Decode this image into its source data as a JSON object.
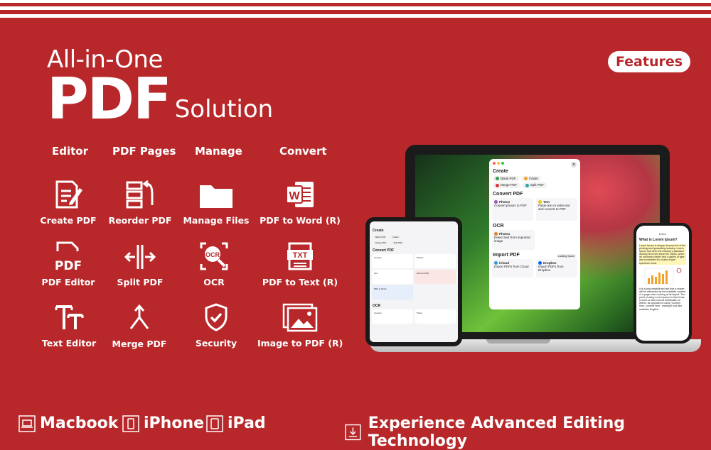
{
  "headline": {
    "line1": "All-in-One",
    "pdf": "PDF",
    "solution": "Solution"
  },
  "badge": "Features",
  "columns": [
    "Editor",
    "PDF Pages",
    "Manage",
    "Convert"
  ],
  "features": [
    [
      "Create PDF",
      "Reorder PDF",
      "Manage Files",
      "PDF to Word (R)"
    ],
    [
      "PDF Editor",
      "Split PDF",
      "OCR",
      "PDF to Text (R)"
    ],
    [
      "Text Editor",
      "Merge PDF",
      "Security",
      "Image to PDF (R)"
    ]
  ],
  "icon_text": {
    "pdf": "PDF",
    "ocr": "OCR",
    "txt": "TXT",
    "word": "W"
  },
  "platforms": [
    "Macbook",
    "iPhone",
    "iPad"
  ],
  "tagline": "Experience Advanced Editing Technology",
  "mac_app": {
    "create_title": "Create",
    "create_items": [
      "Blank PDF",
      "Folder",
      "Merge PDF",
      "Split PDF"
    ],
    "convert_title": "Convert PDF",
    "convert_items": [
      {
        "title": "Photos",
        "desc": "Convert photos to PDF"
      },
      {
        "title": "Text",
        "desc": "Paste text or write text and convert to PDF"
      }
    ],
    "ocr_title": "OCR",
    "ocr_item": {
      "title": "Photos",
      "desc": "Detect text from imported image"
    },
    "import_title": "Import PDF",
    "import_items": [
      {
        "title": "iCloud",
        "desc": "Import PDFs from Cloud"
      },
      {
        "title": "Dropbox",
        "desc": "Import PDFs from Dropbox"
      }
    ],
    "import_badge": "Loading Space"
  },
  "ipad_app": {
    "create_title": "Create",
    "chips": [
      "Blank PDF",
      "Folder",
      "Merge PDF",
      "Split PDF"
    ],
    "convert_title": "Convert PDF",
    "items": [
      "Convert",
      "Photos",
      "Text",
      "Word to PDF",
      "PDF to Word"
    ],
    "ocr_title": "OCR",
    "ocr_items": [
      "Convert",
      "Photo"
    ]
  },
  "iphone_app": {
    "title": "Editor",
    "heading": "What is Lorem Ipsum?",
    "para1": "Lorem Ipsum is simply dummy text of the printing and typesetting industry. Lorem Ipsum has been the industry's standard dummy text ever since the 1500s, when an unknown printer took a galley of type and scrambled it to make a type specimen book.",
    "para2": "It is a long established fact that a reader will be distracted by the readable content of a page when looking at its layout. The point of using Lorem Ipsum is that it has a more-or-less normal distribution of letters, as opposed to using 'Content here, content here', making it look like readable English."
  },
  "colors": {
    "background": "#b8272a",
    "accent_white": "#ffffff"
  }
}
